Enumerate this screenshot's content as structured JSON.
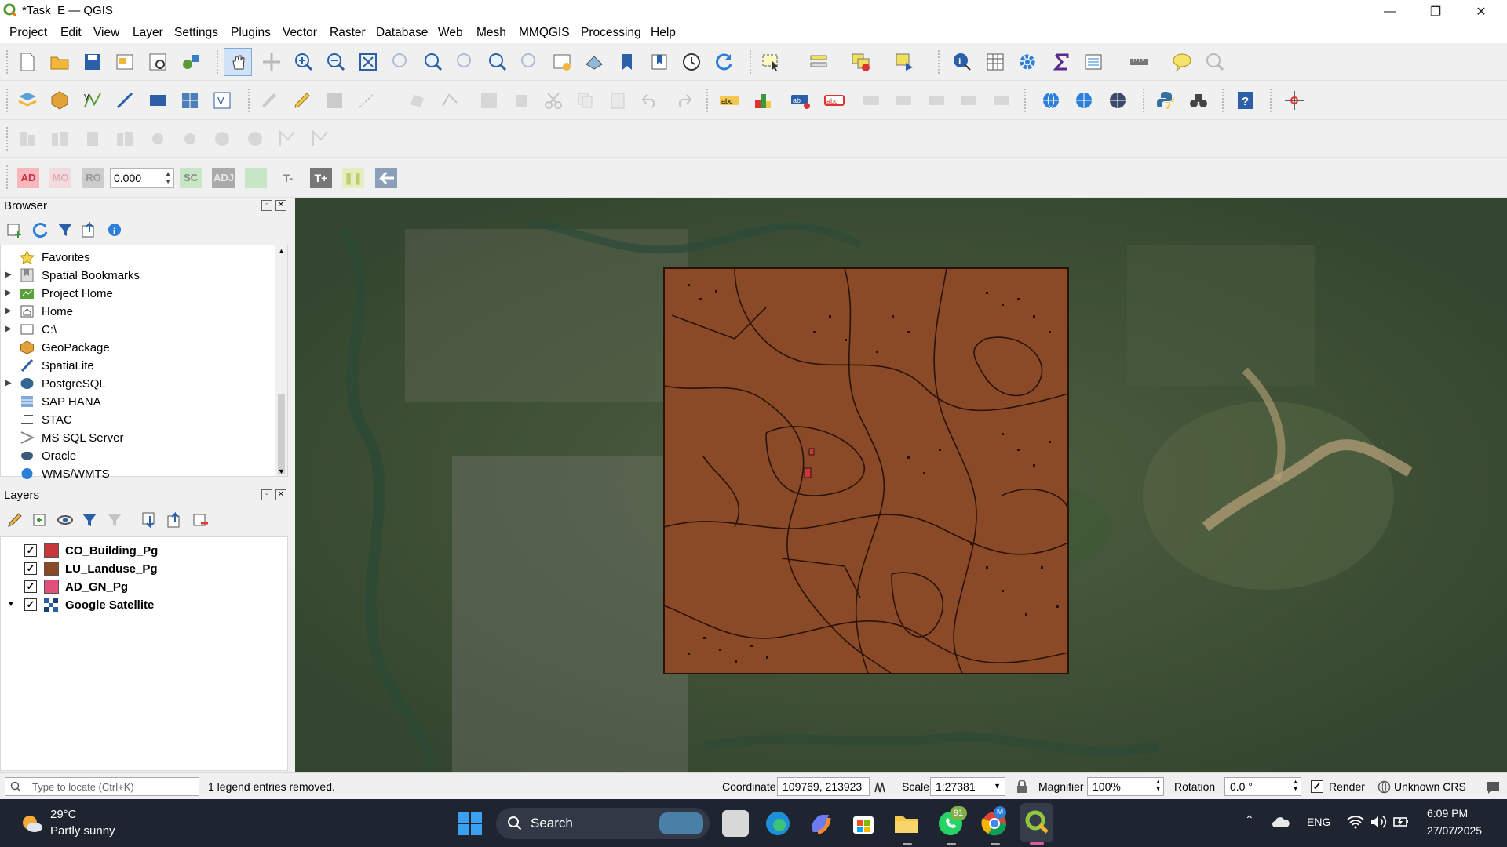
{
  "window": {
    "title": "*Task_E — QGIS",
    "controls": {
      "minimize": "—",
      "maximize": "❐",
      "close": "✕"
    }
  },
  "menu": [
    "Project",
    "Edit",
    "View",
    "Layer",
    "Settings",
    "Plugins",
    "Vector",
    "Raster",
    "Database",
    "Web",
    "Mesh",
    "MMQGIS",
    "Processing",
    "Help"
  ],
  "digitize_toolbar": {
    "ad_label": "AD",
    "mo_label": "MO",
    "ro_label": "RO",
    "value": "0.000",
    "sc_label": "SC",
    "adj_label": "ADJ",
    "t_minus": "T-",
    "t_plus": "T+"
  },
  "browser": {
    "title": "Browser",
    "items": [
      {
        "label": "Favorites",
        "icon": "star-icon",
        "expandable": false
      },
      {
        "label": "Spatial Bookmarks",
        "icon": "bookmark-icon",
        "expandable": true
      },
      {
        "label": "Project Home",
        "icon": "project-home-icon",
        "expandable": true
      },
      {
        "label": "Home",
        "icon": "home-folder-icon",
        "expandable": true
      },
      {
        "label": "C:\\",
        "icon": "drive-icon",
        "expandable": true
      },
      {
        "label": "GeoPackage",
        "icon": "geopackage-icon",
        "expandable": false
      },
      {
        "label": "SpatiaLite",
        "icon": "spatialite-icon",
        "expandable": false
      },
      {
        "label": "PostgreSQL",
        "icon": "postgresql-icon",
        "expandable": true
      },
      {
        "label": "SAP HANA",
        "icon": "sap-hana-icon",
        "expandable": false
      },
      {
        "label": "STAC",
        "icon": "stac-icon",
        "expandable": false
      },
      {
        "label": "MS SQL Server",
        "icon": "mssql-icon",
        "expandable": false
      },
      {
        "label": "Oracle",
        "icon": "oracle-icon",
        "expandable": false
      },
      {
        "label": "WMS/WMTS",
        "icon": "wms-icon",
        "expandable": false
      }
    ]
  },
  "layers": {
    "title": "Layers",
    "items": [
      {
        "label": "CO_Building_Pg",
        "color": "#c8383a",
        "checked": true
      },
      {
        "label": "LU_Landuse_Pg",
        "color": "#8a4a28",
        "checked": true
      },
      {
        "label": "AD_GN_Pg",
        "color": "#e0507a",
        "checked": true
      },
      {
        "label": "Google Satellite",
        "color": "raster",
        "checked": true
      }
    ]
  },
  "status": {
    "locate_placeholder": "Type to locate (Ctrl+K)",
    "message": "1 legend entries removed.",
    "coordinate_label": "Coordinate",
    "coordinate": "109769, 213923",
    "scale_label": "Scale",
    "scale": "1:27381",
    "magnifier_label": "Magnifier",
    "magnifier": "100%",
    "rotation_label": "Rotation",
    "rotation": "0.0 °",
    "render_label": "Render",
    "crs": "Unknown CRS"
  },
  "taskbar": {
    "weather_temp": "29°C",
    "weather_desc": "Partly sunny",
    "search": "Search",
    "lang": "ENG",
    "time": "6:09 PM",
    "date": "27/07/2025",
    "whatsapp_badge": "91"
  },
  "colors": {
    "landuse_fill": "#8a4a28",
    "landuse_outline": "#2a1208",
    "accent": "#1e6fd9"
  }
}
